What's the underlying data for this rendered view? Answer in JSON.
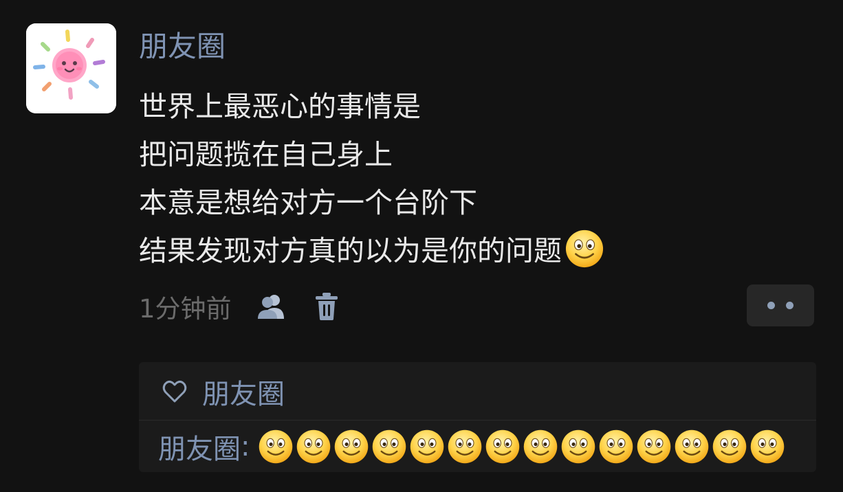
{
  "post": {
    "username": "朋友圈",
    "text_lines": [
      "世界上最恶心的事情是",
      "把问题揽在自己身上",
      "本意是想给对方一个台阶下",
      "结果发现对方真的以为是你的问题"
    ],
    "trailing_emoji": "smiling-face-icon",
    "timestamp": "1分钟前",
    "meta_icons": [
      "people-icon",
      "trash-icon"
    ],
    "more_icon": "more-dots-icon"
  },
  "likes": {
    "icon": "heart-icon",
    "name": "朋友圈"
  },
  "comment": {
    "author": "朋友圈",
    "colon": ":",
    "emoji_count": 14,
    "emoji_icon": "smiling-face-icon"
  },
  "colors": {
    "background": "#121212",
    "username": "#7f93b3",
    "body_text": "#e9e9e9",
    "timestamp": "#6b6b6b",
    "panel": "#1b1b1b",
    "more_button": "#272727"
  }
}
